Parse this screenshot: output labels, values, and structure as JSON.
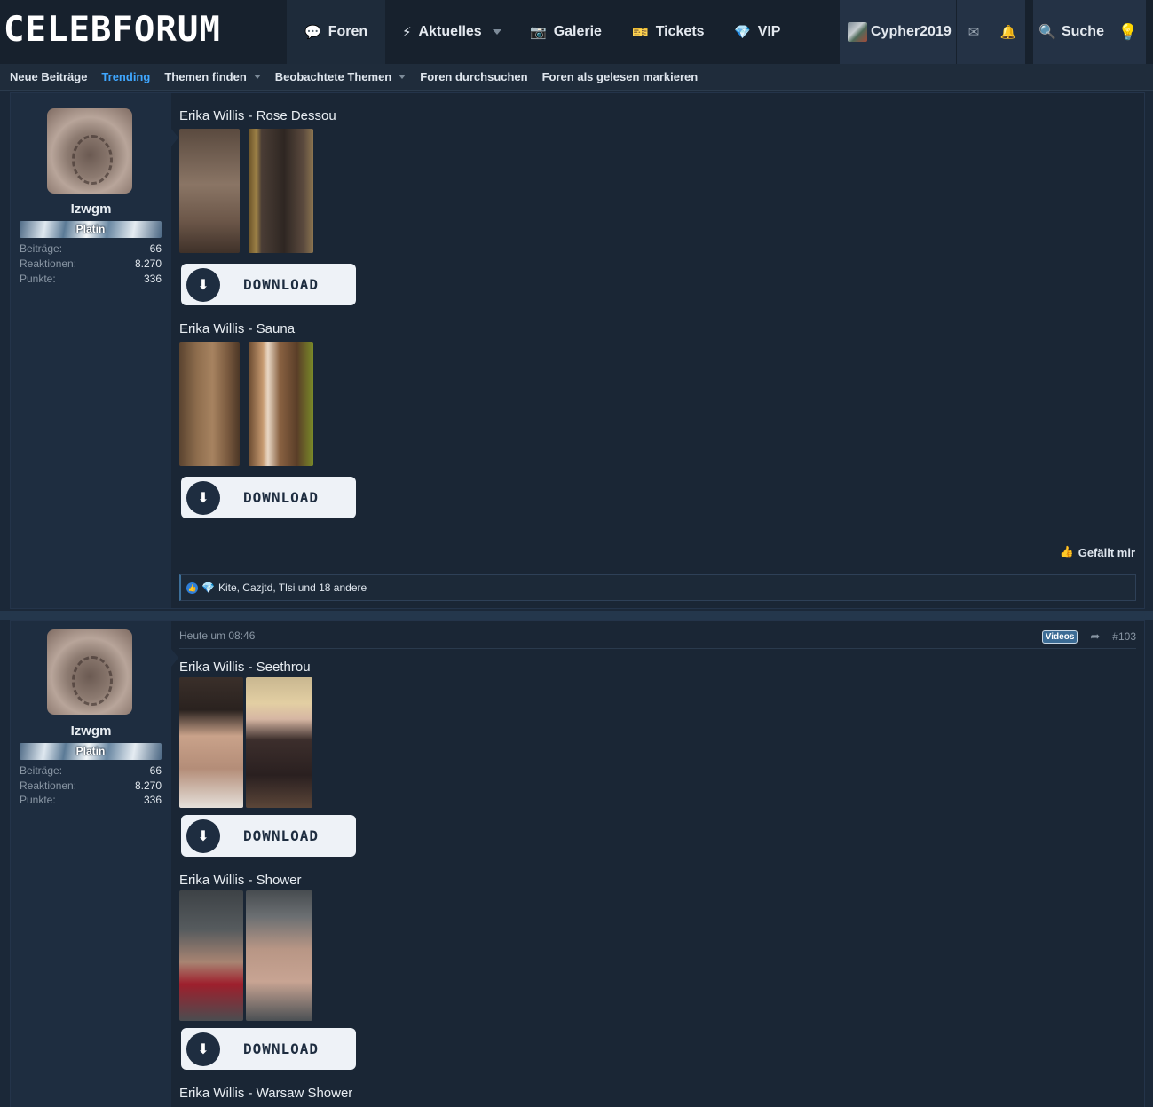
{
  "header": {
    "logo": "CELEBFORUM",
    "tabs": [
      {
        "label": "Foren",
        "icon": "comments-icon"
      },
      {
        "label": "Aktuelles",
        "icon": "bolt-icon"
      },
      {
        "label": "Galerie",
        "icon": "camera-icon"
      },
      {
        "label": "Tickets",
        "icon": "ticket-icon"
      },
      {
        "label": "VIP",
        "icon": "diamond-icon"
      }
    ],
    "username": "Cypher2019",
    "search_label": "Suche"
  },
  "subnav": {
    "items": [
      "Neue Beiträge",
      "Trending",
      "Themen finden",
      "Beobachtete Themen",
      "Foren durchsuchen",
      "Foren als gelesen markieren"
    ]
  },
  "posts": [
    {
      "user": {
        "name": "Izwgm",
        "rank": "Platin",
        "stats": [
          {
            "label": "Beiträge:",
            "value": "66"
          },
          {
            "label": "Reaktionen:",
            "value": "8.270"
          },
          {
            "label": "Punkte:",
            "value": "336"
          }
        ]
      },
      "entries": [
        {
          "title": "Erika Willis - Rose Dessou",
          "download": "DOWNLOAD"
        },
        {
          "title": "Erika Willis - Sauna",
          "download": "DOWNLOAD"
        }
      ],
      "like_label": "Gefällt mir",
      "reactions": "Kite, Cazjtd, Tlsi und 18 andere"
    },
    {
      "meta": {
        "time": "Heute um 08:46",
        "badge": "Videos",
        "number": "#103"
      },
      "user": {
        "name": "Izwgm",
        "rank": "Platin",
        "stats": [
          {
            "label": "Beiträge:",
            "value": "66"
          },
          {
            "label": "Reaktionen:",
            "value": "8.270"
          },
          {
            "label": "Punkte:",
            "value": "336"
          }
        ]
      },
      "entries": [
        {
          "title": "Erika Willis - Seethrou",
          "download": "DOWNLOAD"
        },
        {
          "title": "Erika Willis - Shower",
          "download": "DOWNLOAD"
        },
        {
          "title": "Erika Willis - Warsaw Shower"
        }
      ]
    }
  ]
}
